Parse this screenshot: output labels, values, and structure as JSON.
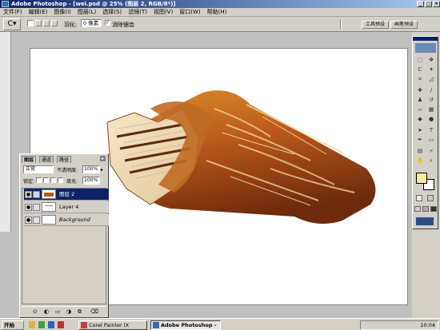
{
  "window": {
    "title": "Adobe Photoshop - [wei.psd @ 25% (图层 2, RGB/8*)]"
  },
  "menus": [
    "文件(F)",
    "编辑(E)",
    "图像(I)",
    "图层(L)",
    "选择(S)",
    "滤镜(T)",
    "视图(V)",
    "窗口(W)",
    "帮助(H)"
  ],
  "options": {
    "feather_label": "羽化:",
    "feather_value": "0 像素",
    "antialias_label": "消除锯齿",
    "palette_btn1": "工具预设",
    "palette_btn2": "画笔预设"
  },
  "layers_panel": {
    "tabs": [
      "图层",
      "通道",
      "路径"
    ],
    "blend_mode": "正常",
    "opacity_label": "不透明度:",
    "opacity_value": "100%",
    "lock_label": "锁定:",
    "fill_label": "填充:",
    "fill_value": "100%",
    "layers": [
      {
        "name": "图层 2",
        "selected": true
      },
      {
        "name": "Layer 4",
        "selected": false
      },
      {
        "name": "Background",
        "selected": false
      }
    ]
  },
  "colors": {
    "foreground": "#f7ed9e",
    "background": "#ffffff",
    "selection": "#0a246a"
  },
  "taskbar": {
    "start_label": "开始",
    "tasks": [
      "Corel Painter IX",
      "Adobe Photoshop - [w..."
    ],
    "clock": "10:04"
  }
}
